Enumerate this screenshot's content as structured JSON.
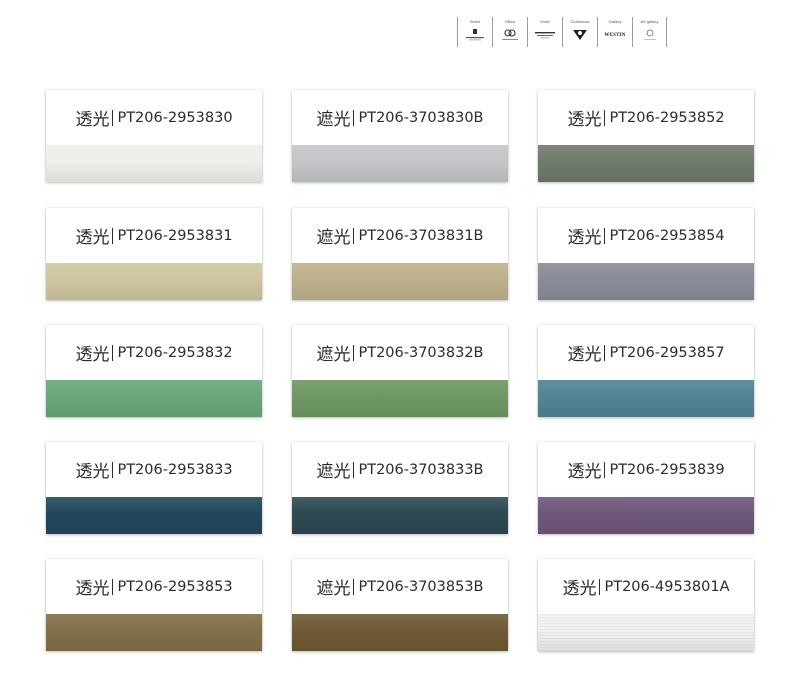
{
  "categories": [
    {
      "label": "Home",
      "logo": "mandarin-logo-icon"
    },
    {
      "label": "Office",
      "logo": "ring-logo-icon"
    },
    {
      "label": "Hotel",
      "logo": "courtyard-logo-icon"
    },
    {
      "label": "Clubhouse",
      "logo": "clubhouse-logo-icon"
    },
    {
      "label": "Gallery",
      "logo": "westin-logo-icon",
      "logo_text": "WESTIN"
    },
    {
      "label": "Art gallery",
      "logo": "art-gallery-logo-icon"
    }
  ],
  "swatches": [
    {
      "type": "透光",
      "code": "PT206-2953830",
      "color": "#eeeeea"
    },
    {
      "type": "遮光",
      "code": "PT206-3703830B",
      "color": "#c3c6c9"
    },
    {
      "type": "透光",
      "code": "PT206-2953852",
      "color": "#6e7a6c"
    },
    {
      "type": "透光",
      "code": "PT206-2953831",
      "color": "#cfc59f"
    },
    {
      "type": "遮光",
      "code": "PT206-3703831B",
      "color": "#bdb08b"
    },
    {
      "type": "透光",
      "code": "PT206-2953854",
      "color": "#878c98"
    },
    {
      "type": "透光",
      "code": "PT206-2953832",
      "color": "#6aa777"
    },
    {
      "type": "遮光",
      "code": "PT206-3703832B",
      "color": "#6e9763"
    },
    {
      "type": "透光",
      "code": "PT206-2953857",
      "color": "#4f8494"
    },
    {
      "type": "透光",
      "code": "PT206-2953833",
      "color": "#22475a"
    },
    {
      "type": "遮光",
      "code": "PT206-3703833B",
      "color": "#2d4a53"
    },
    {
      "type": "透光",
      "code": "PT206-2953839",
      "color": "#6e577a"
    },
    {
      "type": "透光",
      "code": "PT206-2953853",
      "color": "#826f47"
    },
    {
      "type": "遮光",
      "code": "PT206-3703853B",
      "color": "#6e5a33"
    },
    {
      "type": "透光",
      "code": "PT206-4953801A",
      "color": "#f1f1f1"
    }
  ]
}
